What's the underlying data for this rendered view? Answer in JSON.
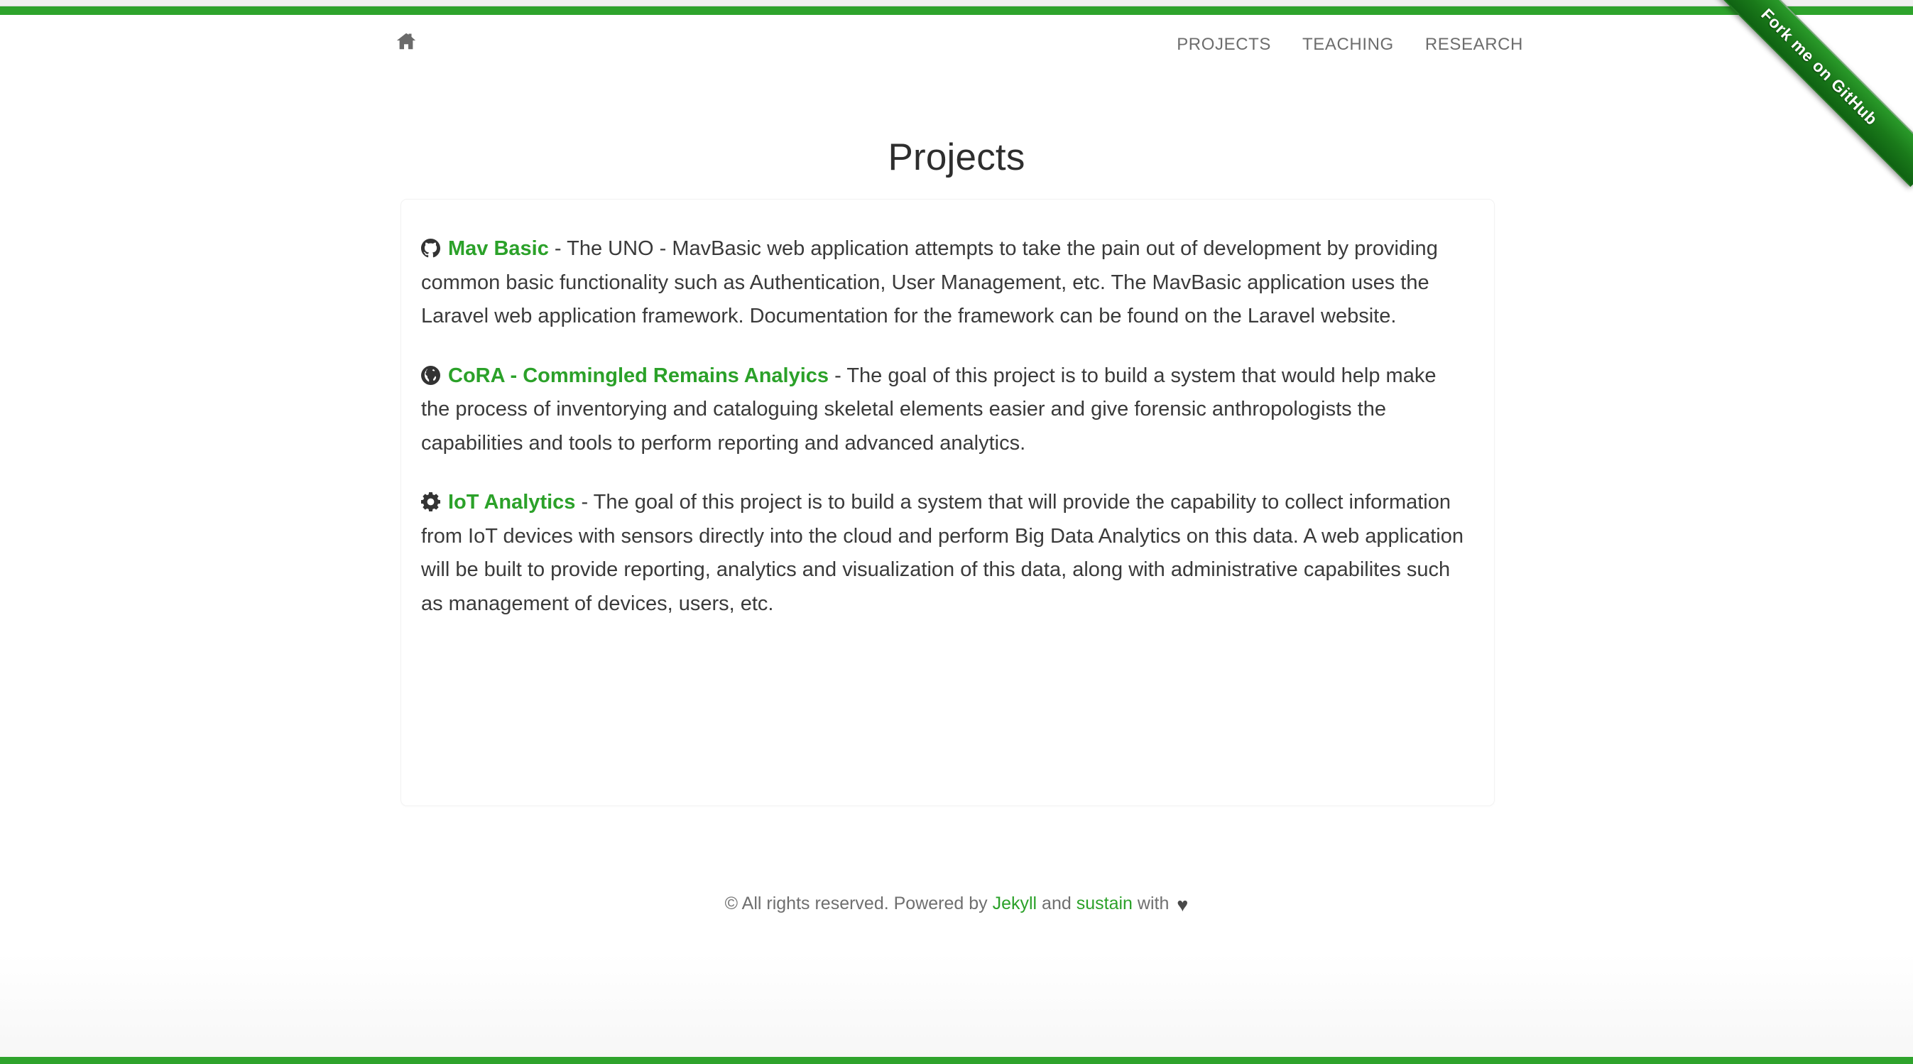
{
  "theme": {
    "accent_green": "#2ea32c",
    "link_green": "#2ba129",
    "body_text": "#3a3a3a",
    "nav_text": "#6d6d6d",
    "footer_text": "#6f6f6f"
  },
  "ribbon": {
    "label": "Fork me on GitHub",
    "icon": "github-ribbon"
  },
  "navbar": {
    "home_icon": "home-icon",
    "links": [
      {
        "label": "PROJECTS"
      },
      {
        "label": "TEACHING"
      },
      {
        "label": "RESEARCH"
      }
    ]
  },
  "page": {
    "title": "Projects"
  },
  "projects": [
    {
      "icon": "github-icon",
      "name": "Mav Basic",
      "separator": " - ",
      "description": "The UNO - MavBasic web application attempts to take the pain out of development by providing common basic functionality such as Authentication, User Management, etc. The MavBasic application uses the Laravel web application framework. Documentation for the framework can be found on the Laravel website."
    },
    {
      "icon": "globe-icon",
      "name": "CoRA - Commingled Remains Analyics",
      "separator": " - ",
      "description": "The goal of this project is to build a system that would help make the process of inventorying and cataloguing skeletal elements easier and give forensic anthropologists the capabilities and tools to perform reporting and advanced analytics."
    },
    {
      "icon": "gear-icon",
      "name": "IoT Analytics",
      "separator": " - ",
      "description": "The goal of this project is to build a system that will provide the capability to collect information from IoT devices with sensors directly into the cloud and perform Big Data Analytics on this data. A web application will be built to provide reporting, analytics and visualization of this data, along with administrative capabilites such as management of devices, users, etc."
    }
  ],
  "footer": {
    "copyright": "© All rights reserved. Powered by ",
    "jekyll_label": "Jekyll",
    "and_label": " and ",
    "sustain_label": "sustain",
    "with_label": " with ",
    "heart_icon": "heart-icon",
    "heart_glyph": "♥"
  }
}
